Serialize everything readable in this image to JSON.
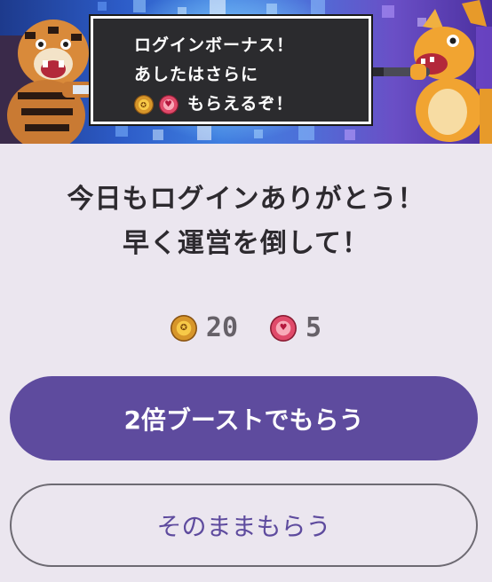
{
  "banner": {
    "speech": {
      "line1": "ログインボーナス！",
      "line2": "あしたはさらに",
      "line3": "もらえるぞ！",
      "line3_icons": [
        "gold-coin-icon",
        "heart-coin-icon"
      ]
    }
  },
  "message": {
    "line1": "今日もログインありがとう！",
    "line2": "早く運営を倒して！"
  },
  "rewards": [
    {
      "icon": "gold-coin-icon",
      "count": "20",
      "color": "#d7962a"
    },
    {
      "icon": "heart-coin-icon",
      "count": "5",
      "color": "#e04a6a"
    }
  ],
  "buttons": {
    "boost_label": "2倍ブーストでもらう",
    "claim_label": "そのままもらう"
  },
  "colors": {
    "background": "#ebe6ef",
    "accent": "#5e4b9e",
    "text": "#2d2a2f"
  }
}
